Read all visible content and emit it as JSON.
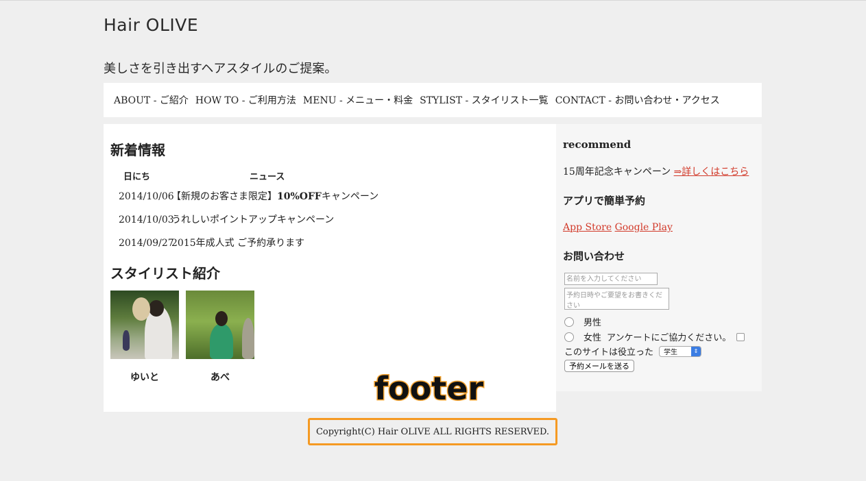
{
  "site": {
    "logo": "Hair OLIVE",
    "tagline": "美しさを引き出すヘアスタイルのご提案。"
  },
  "nav": [
    {
      "label": "ABOUT - ご紹介"
    },
    {
      "label": "HOW TO - ご利用方法"
    },
    {
      "label": "MENU - メニュー・料金"
    },
    {
      "label": "STYLIST - スタイリスト一覧"
    },
    {
      "label": "CONTACT - お問い合わせ・アクセス"
    }
  ],
  "news": {
    "title": "新着情報",
    "col_date": "日にち",
    "col_news": "ニュース",
    "items": [
      {
        "date": "2014/10/06",
        "pre": "【新規のお客さま限定】",
        "bold": "10%OFF",
        "post": "キャンペーン"
      },
      {
        "date": "2014/10/03",
        "pre": "うれしいポイントアップキャンペーン",
        "bold": "",
        "post": ""
      },
      {
        "date": "2014/09/27",
        "pre": "2015年成人式 ご予約承ります",
        "bold": "",
        "post": ""
      }
    ]
  },
  "stylists": {
    "title": "スタイリスト紹介",
    "items": [
      {
        "name": "ゆいと"
      },
      {
        "name": "あべ"
      }
    ]
  },
  "sidebar": {
    "recommend_title": "recommend",
    "campaign_text": "15周年記念キャンペーン ",
    "campaign_link": "⇒詳しくはこちら",
    "app_title": "アプリで簡単予約",
    "app_store": "App Store",
    "google_play": "Google Play",
    "contact_title": "お問い合わせ",
    "name_placeholder": "名前を入力してください",
    "message_placeholder": "予約日時やご要望をお書きください",
    "male": "男性",
    "female": "女性",
    "survey": "アンケートにご協力ください。",
    "useful": "このサイトは役立った",
    "useful_selected": "学生",
    "submit": "予約メールを送る"
  },
  "annotation": {
    "footer_label": "footer"
  },
  "footer": {
    "copyright": "Copyright(C) Hair OLIVE ALL RIGHTS RESERVED."
  }
}
